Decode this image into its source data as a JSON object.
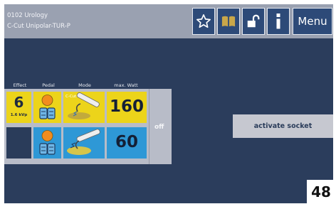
{
  "header": {
    "program_line": "0102 Urology",
    "mode_line": "C-Cut Unipolar-TUR-P",
    "buttons": [
      {
        "icon": "star-icon"
      },
      {
        "icon": "book-icon"
      },
      {
        "icon": "unlock-icon"
      },
      {
        "icon": "info-icon"
      }
    ],
    "menu_label": "Menu"
  },
  "columns": {
    "effect": "Effect",
    "pedal": "Pedal",
    "mode": "Mode",
    "max_watt": "max. Watt"
  },
  "rows": [
    {
      "effect_value": "6",
      "effect_unit": "1.6 kVp",
      "mode_badge": "C-Cut",
      "watt": "160",
      "pedal_color": "#f28c1e",
      "watt_color": "#ecd41a"
    },
    {
      "effect_value": "",
      "watt": "60",
      "pedal_color": "#f28c1e",
      "watt_color": "#2e98d6"
    }
  ],
  "off_label": "off",
  "activate_label": "activate socket",
  "page_number": "48",
  "colors": {
    "screen_bg": "#2b3d5c",
    "header_bg": "#9aa1b1",
    "button_bg": "#2d4a78"
  }
}
